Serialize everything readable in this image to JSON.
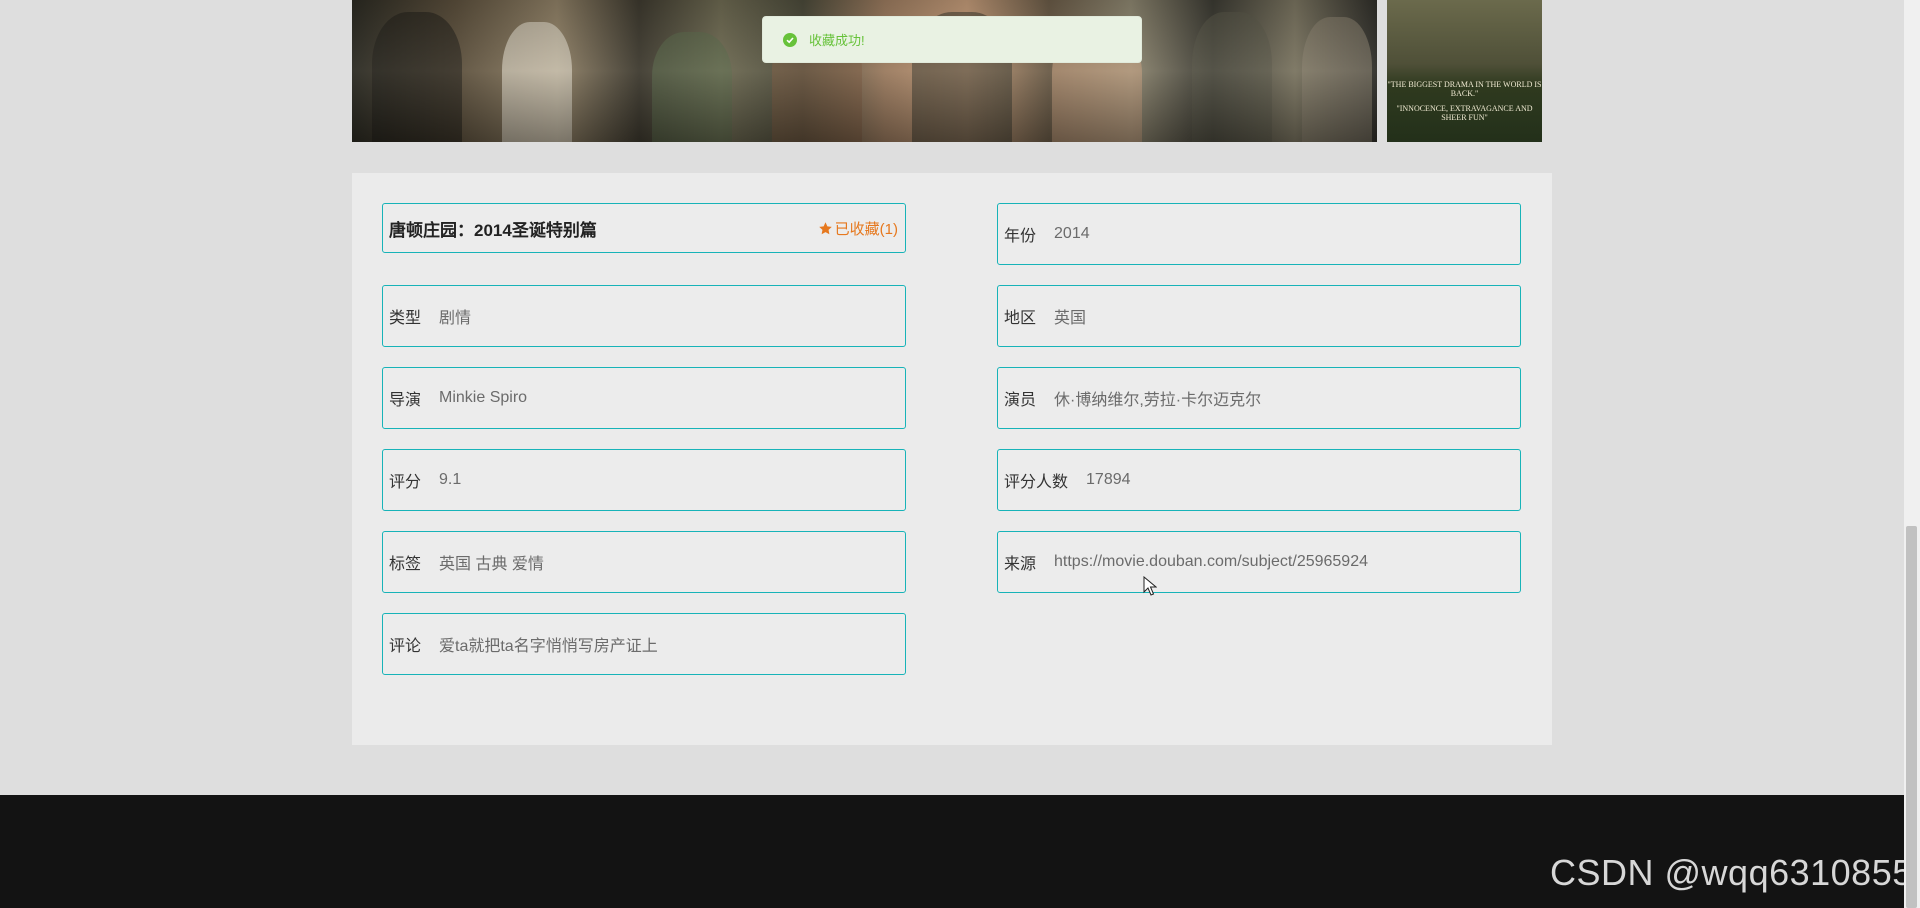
{
  "toast": {
    "message": "收藏成功!",
    "icon": "check-circle-icon",
    "color": "#67c23a"
  },
  "banner": {
    "poster_quote_1": "\"THE BIGGEST DRAMA IN THE WORLD IS BACK.\"",
    "poster_quote_2": "\"INNOCENCE, EXTRAVAGANCE AND SHEER FUN\""
  },
  "movie": {
    "title": "唐顿庄园：2014圣诞特别篇",
    "favorite": {
      "label": "已收藏(1)",
      "icon": "star-icon",
      "color": "#e6781e"
    },
    "fields": {
      "year": {
        "label": "年份",
        "value": "2014"
      },
      "genre": {
        "label": "类型",
        "value": "剧情"
      },
      "region": {
        "label": "地区",
        "value": "英国"
      },
      "director": {
        "label": "导演",
        "value": "Minkie Spiro"
      },
      "actors": {
        "label": "演员",
        "value": "休·博纳维尔,劳拉·卡尔迈克尔"
      },
      "rating": {
        "label": "评分",
        "value": "9.1"
      },
      "rating_count": {
        "label": "评分人数",
        "value": "17894"
      },
      "tags": {
        "label": "标签",
        "value": "英国 古典 爱情"
      },
      "source": {
        "label": "来源",
        "value": "https://movie.douban.com/subject/25965924"
      },
      "comment": {
        "label": "评论",
        "value": "爱ta就把ta名字悄悄写房产证上"
      }
    }
  },
  "watermark": "CSDN @wqq6310855",
  "colors": {
    "border": "#17b3b8",
    "footer": "#131313"
  }
}
